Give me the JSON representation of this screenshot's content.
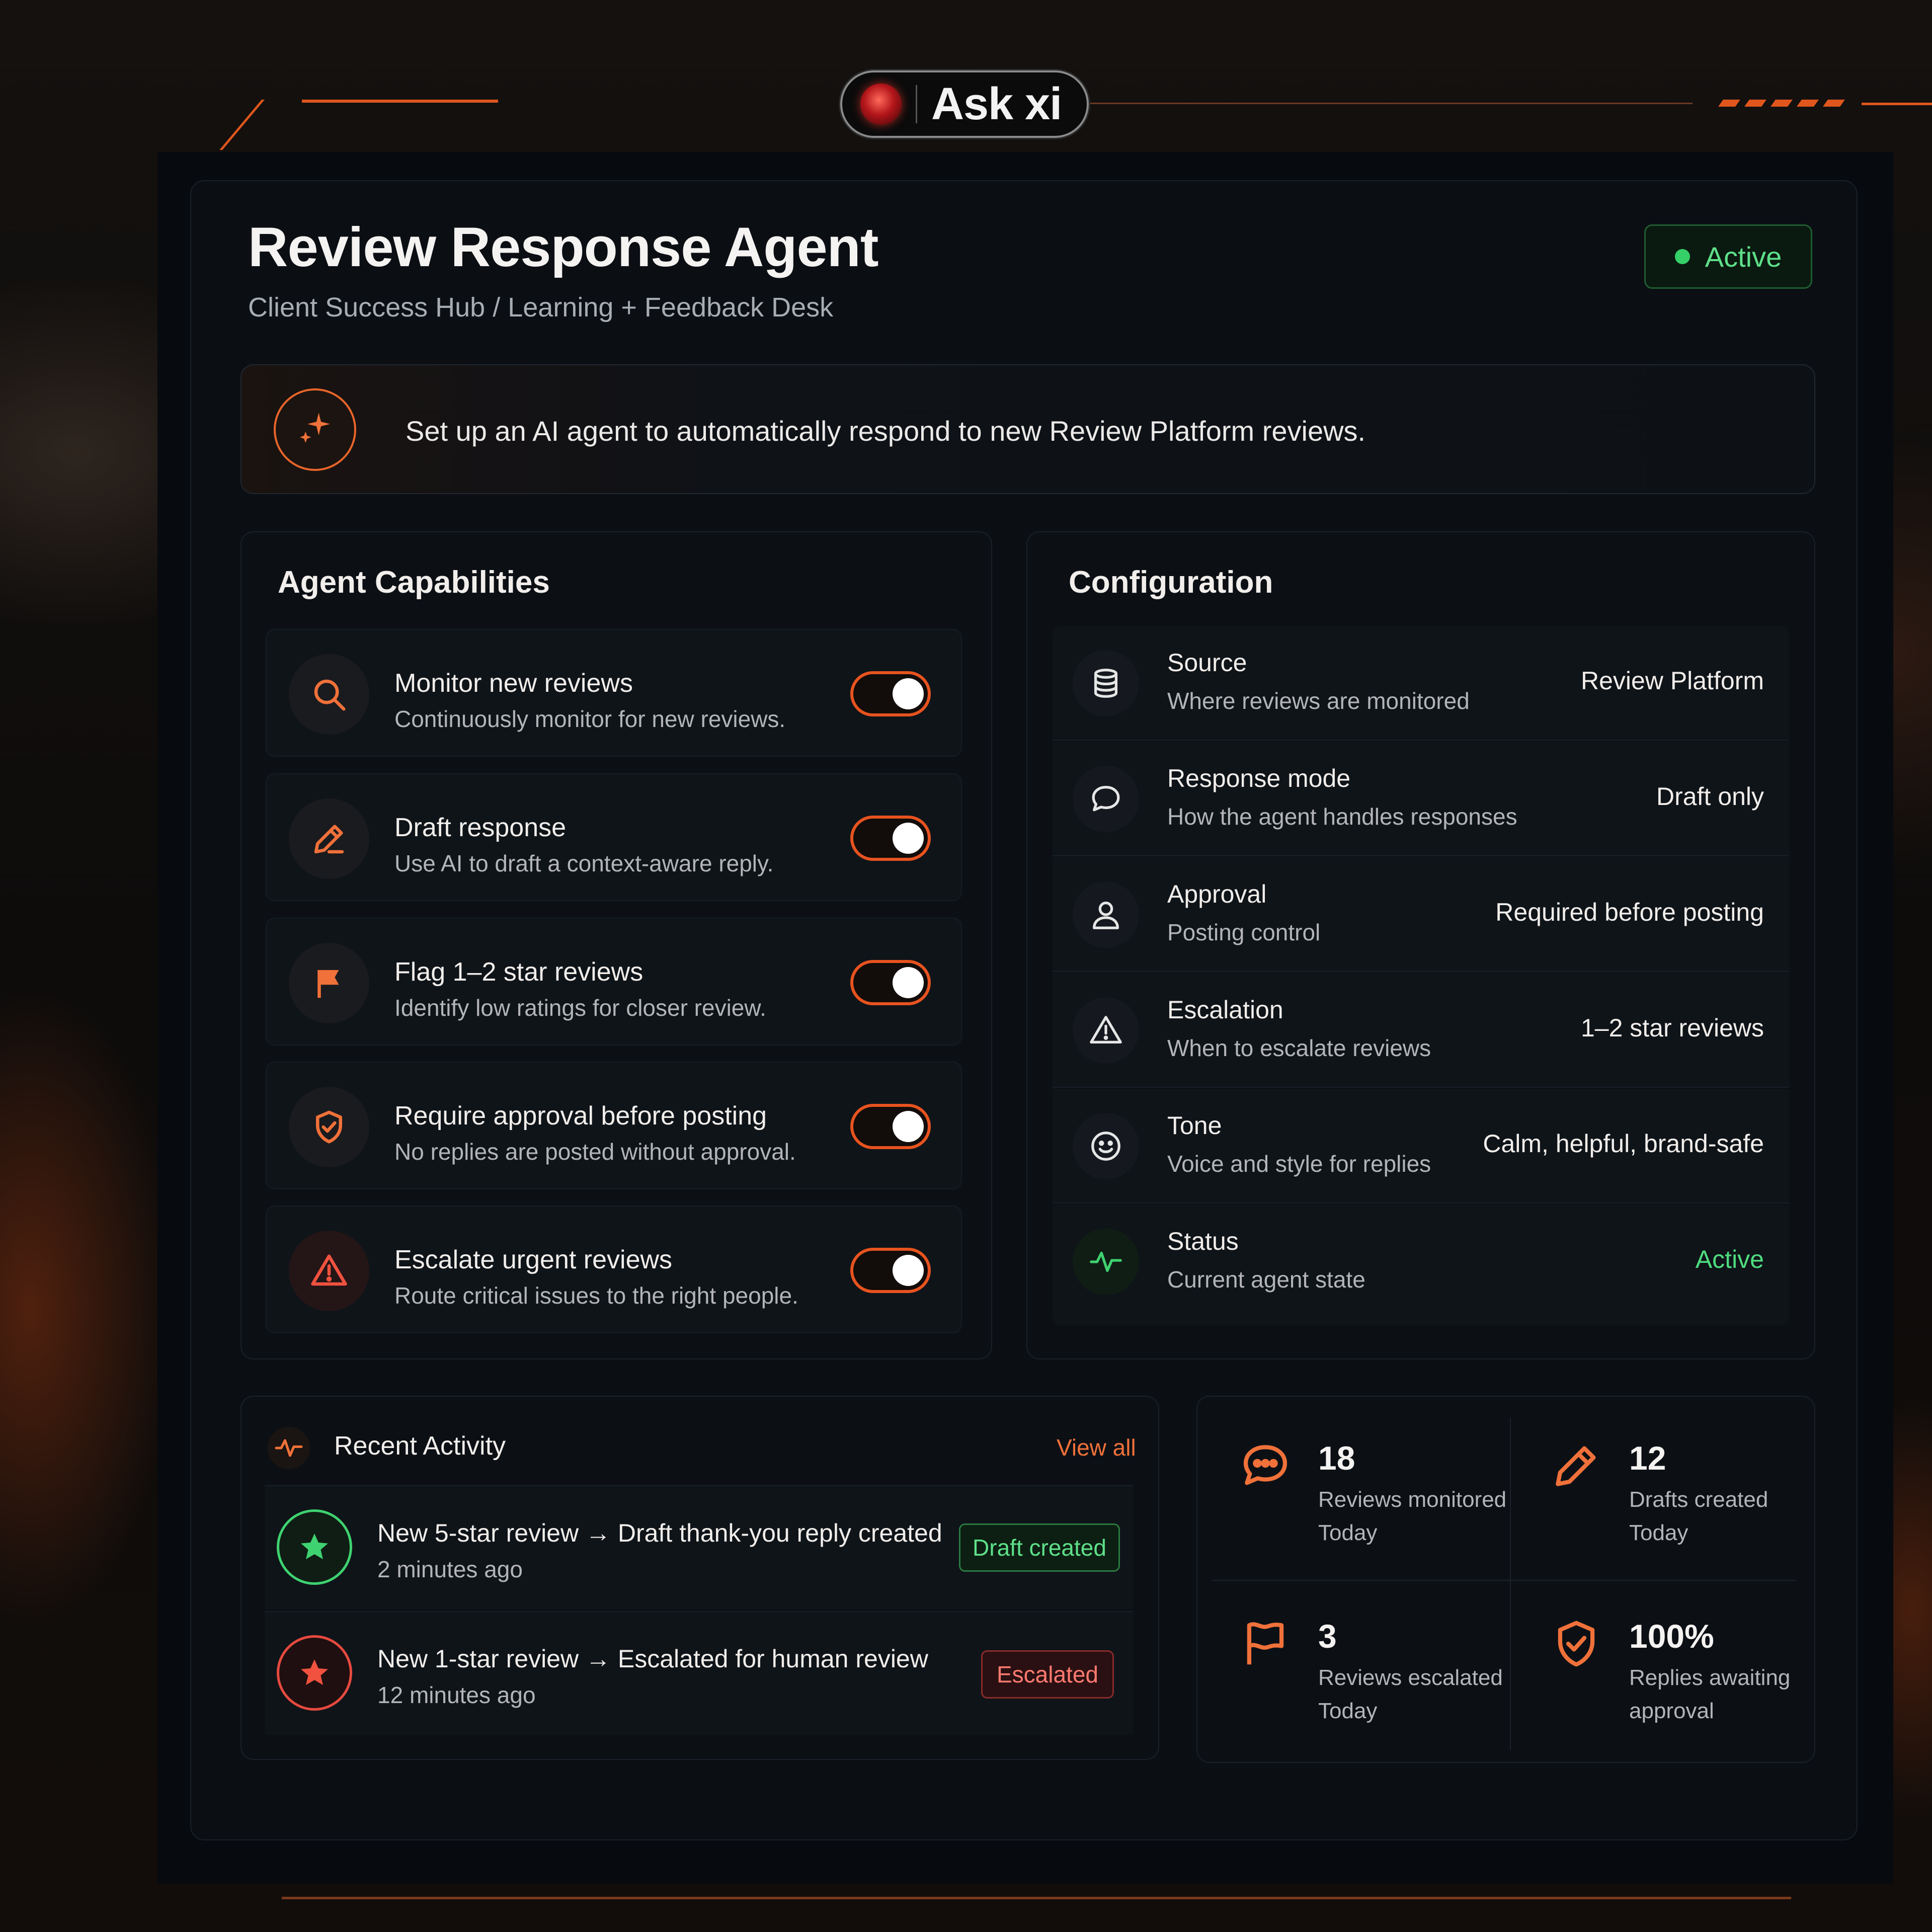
{
  "brand": {
    "logo_text": "Ask xi"
  },
  "header": {
    "title": "Review Response Agent",
    "breadcrumb": "Client Success Hub / Learning + Feedback Desk",
    "status_badge": "Active"
  },
  "intro": {
    "text": "Set up an AI agent to automatically respond to new Review Platform reviews.",
    "icon": "sparkle-icon"
  },
  "capabilities": {
    "title": "Agent Capabilities",
    "items": [
      {
        "title": "Monitor new reviews",
        "description": "Continuously monitor for new reviews.",
        "icon": "search-icon",
        "enabled": true
      },
      {
        "title": "Draft response",
        "description": "Use AI to draft a context-aware reply.",
        "icon": "pencil-icon",
        "enabled": true
      },
      {
        "title": "Flag 1–2 star reviews",
        "description": "Identify low ratings for closer review.",
        "icon": "flag-icon",
        "enabled": true
      },
      {
        "title": "Require approval before posting",
        "description": "No replies are posted without approval.",
        "icon": "shield-check-icon",
        "enabled": true
      },
      {
        "title": "Escalate urgent reviews",
        "description": "Route critical issues to the right people.",
        "icon": "warning-icon",
        "enabled": true
      }
    ]
  },
  "configuration": {
    "title": "Configuration",
    "items": [
      {
        "title": "Source",
        "description": "Where reviews are monitored",
        "value": "Review Platform",
        "icon": "database-icon"
      },
      {
        "title": "Response mode",
        "description": "How the agent handles responses",
        "value": "Draft only",
        "icon": "chat-bubble-icon"
      },
      {
        "title": "Approval",
        "description": "Posting control",
        "value": "Required before posting",
        "icon": "user-icon"
      },
      {
        "title": "Escalation",
        "description": "When to escalate reviews",
        "value": "1–2 star reviews",
        "icon": "warning-icon"
      },
      {
        "title": "Tone",
        "description": "Voice and style for replies",
        "value": "Calm, helpful, brand-safe",
        "icon": "smile-icon"
      },
      {
        "title": "Status",
        "description": "Current agent state",
        "value": "Active",
        "icon": "pulse-icon"
      }
    ]
  },
  "activity": {
    "title": "Recent Activity",
    "view_all": "View all",
    "items": [
      {
        "title": "New 5-star review → Draft thank-you reply created",
        "time": "2 minutes ago",
        "tag": "Draft created",
        "icon": "star-icon"
      },
      {
        "title": "New 1-star review → Escalated for human review",
        "time": "12 minutes ago",
        "tag": "Escalated",
        "icon": "star-icon"
      }
    ]
  },
  "stats": [
    {
      "value": "18",
      "label_line1": "Reviews monitored",
      "label_line2": "Today",
      "icon": "chat-dots-icon"
    },
    {
      "value": "12",
      "label_line1": "Drafts created",
      "label_line2": "Today",
      "icon": "pencil-icon"
    },
    {
      "value": "3",
      "label_line1": "Reviews escalated",
      "label_line2": "Today",
      "icon": "flag-icon"
    },
    {
      "value": "100%",
      "label_line1": "Replies awaiting",
      "label_line2": "approval",
      "icon": "shield-check-icon"
    }
  ],
  "colors": {
    "accent": "#e8531f",
    "success": "#36d068",
    "danger": "#e84a3f",
    "background": "#0b0f14"
  }
}
